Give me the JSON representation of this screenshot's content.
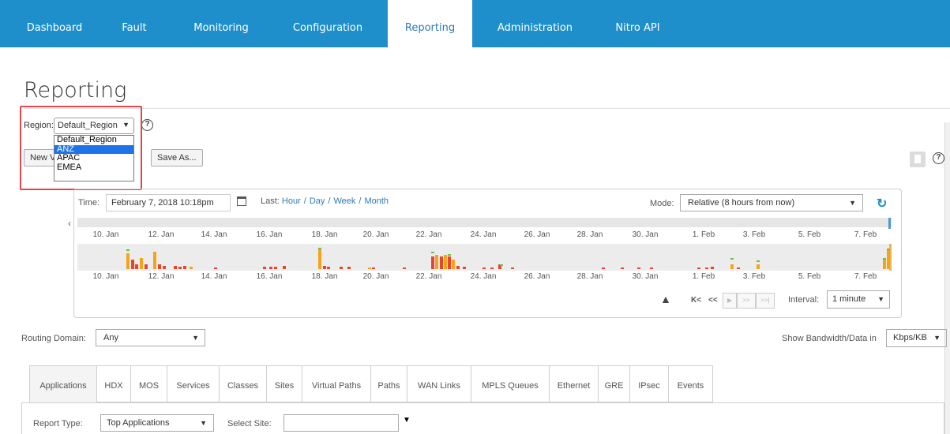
{
  "nav": {
    "items": [
      {
        "label": "Dashboard"
      },
      {
        "label": "Fault"
      },
      {
        "label": "Monitoring"
      },
      {
        "label": "Configuration"
      },
      {
        "label": "Reporting",
        "active": true
      },
      {
        "label": "Administration"
      },
      {
        "label": "Nitro API"
      }
    ]
  },
  "page": {
    "title": "Reporting"
  },
  "region": {
    "label": "Region:",
    "selected": "Default_Region",
    "options": [
      "Default_Region",
      "ANZ",
      "APAC",
      "EMEA"
    ],
    "highlighted": "ANZ"
  },
  "toolbar": {
    "new_view_label": "New V",
    "save_as_label": "Save As..."
  },
  "help_icon": "?",
  "timeline": {
    "time_label": "Time:",
    "time_value": "February 7, 2018 10:18pm",
    "last_label": "Last:",
    "ranges": [
      "Hour",
      "Day",
      "Week",
      "Month"
    ],
    "mode_label": "Mode:",
    "mode_value": "Relative (8 hours from now)",
    "interval_label": "Interval:",
    "interval_value": "1 minute",
    "axis_labels": [
      "10. Jan",
      "12. Jan",
      "14. Jan",
      "16. Jan",
      "18. Jan",
      "20. Jan",
      "22. Jan",
      "24. Jan",
      "26. Jan",
      "28. Jan",
      "30. Jan",
      "1. Feb",
      "3. Feb",
      "5. Feb",
      "7. Feb"
    ],
    "controls": {
      "first": "K<",
      "prev": "<<",
      "play": "▶",
      "next": ">>",
      "last": ">>|"
    }
  },
  "routing": {
    "label": "Routing Domain:",
    "value": "Any"
  },
  "bandwidth": {
    "label": "Show Bandwidth/Data in",
    "value": "Kbps/KB"
  },
  "tabs": [
    "Applications",
    "HDX",
    "MOS",
    "Services",
    "Classes",
    "Sites",
    "Virtual Paths",
    "Paths",
    "WAN Links",
    "MPLS Queues",
    "Ethernet",
    "GRE",
    "IPsec",
    "Events"
  ],
  "report": {
    "type_label": "Report Type:",
    "type_value": "Top Applications",
    "site_label": "Select Site:",
    "site_value": ""
  },
  "colors": {
    "accent": "#1f8fcb",
    "bar_red": "#e8452c",
    "bar_orange": "#f5a31a",
    "bar_green": "#6cc04a",
    "highlight": "#e0474c"
  },
  "icons": [
    "help-icon",
    "calendar-icon",
    "refresh-icon",
    "warning-icon",
    "trash-icon",
    "chevron-left-icon"
  ]
}
